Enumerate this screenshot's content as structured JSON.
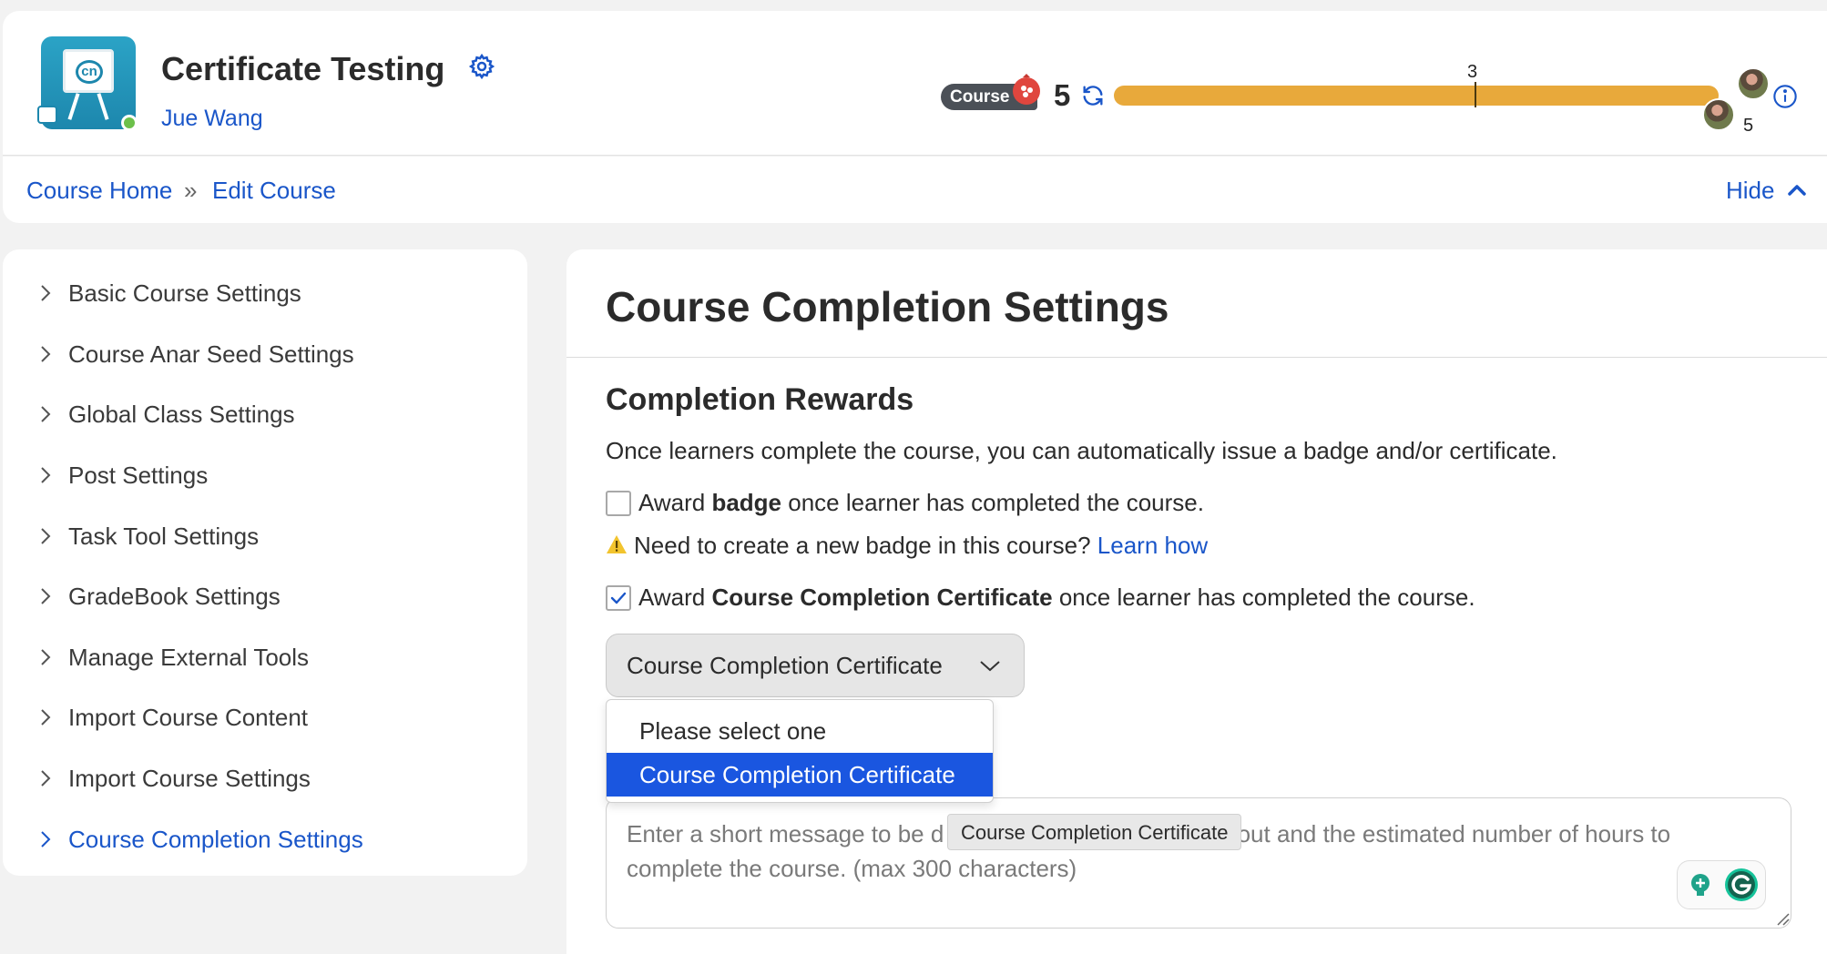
{
  "header": {
    "course_title": "Certificate Testing",
    "instructor_name": "Jue Wang",
    "course_pill": "Course",
    "seed_score": "5",
    "progress_marker_label": "3",
    "avatar_count": "5"
  },
  "breadcrumb": {
    "home": "Course Home",
    "separator": "»",
    "current": "Edit Course",
    "hide": "Hide"
  },
  "sidebar": {
    "items": [
      {
        "label": "Basic Course Settings"
      },
      {
        "label": "Course Anar Seed Settings"
      },
      {
        "label": "Global Class Settings"
      },
      {
        "label": "Post Settings"
      },
      {
        "label": "Task Tool Settings"
      },
      {
        "label": "GradeBook Settings"
      },
      {
        "label": "Manage External Tools"
      },
      {
        "label": "Import Course Content"
      },
      {
        "label": "Import Course Settings"
      },
      {
        "label": "Course Completion Settings"
      }
    ],
    "active_index": 9
  },
  "main": {
    "title": "Course Completion Settings",
    "section_title": "Completion Rewards",
    "section_desc": "Once learners complete the course, you can automatically issue a badge and/or certificate.",
    "badge_check": {
      "prefix": "Award ",
      "bold": "badge",
      "suffix": " once learner has completed the course.",
      "checked": false
    },
    "warning": {
      "text": "Need to create a new badge in this course?",
      "link": "Learn how"
    },
    "cert_check": {
      "prefix": "Award ",
      "bold": "Course Completion Certificate",
      "suffix": " once learner has completed the course.",
      "checked": true
    },
    "certificate_select": {
      "value": "Course Completion Certificate",
      "options": [
        "Please select one",
        "Course Completion Certificate"
      ],
      "selected_index": 1
    },
    "message": {
      "placeholder": "Enter a short message to be d                                     ch as what the course is about and the estimated number of hours to complete the course. (max 300 characters)",
      "tooltip": "Course Completion Certificate"
    }
  },
  "colors": {
    "link": "#1a56c9",
    "progress": "#e8a93b",
    "selected_option": "#1a56e0"
  }
}
